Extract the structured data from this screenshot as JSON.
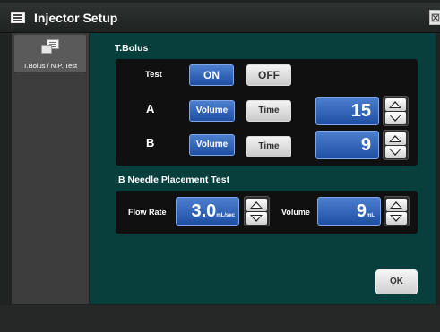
{
  "window": {
    "title": "Injector Setup",
    "close_glyph": "⊠"
  },
  "sidebar": {
    "items": [
      {
        "label": "T.Bolus / N.P. Test",
        "icon": "document-stack-icon",
        "selected": true
      }
    ]
  },
  "tbolus": {
    "title": "T.Bolus",
    "test_label": "Test",
    "test_on": "ON",
    "test_off": "OFF",
    "test_selected": "ON",
    "row_a": {
      "label": "A",
      "volume_label": "Volume",
      "time_label": "Time",
      "selected": "Volume",
      "value": "15"
    },
    "row_b": {
      "label": "B",
      "volume_label": "Volume",
      "time_label": "Time",
      "selected": "Volume",
      "value": "9"
    }
  },
  "np_test": {
    "title": "B Needle Placement Test",
    "flow_rate_label": "Flow Rate",
    "flow_rate_value": "3.0",
    "flow_rate_unit": "mL/sec",
    "volume_label": "Volume",
    "volume_value": "9",
    "volume_unit": "mL"
  },
  "ok_label": "OK",
  "colors": {
    "panel_bg": "#073f3d",
    "selected_button": "#2a5cb0",
    "unselected_button": "#d8d8d8"
  }
}
